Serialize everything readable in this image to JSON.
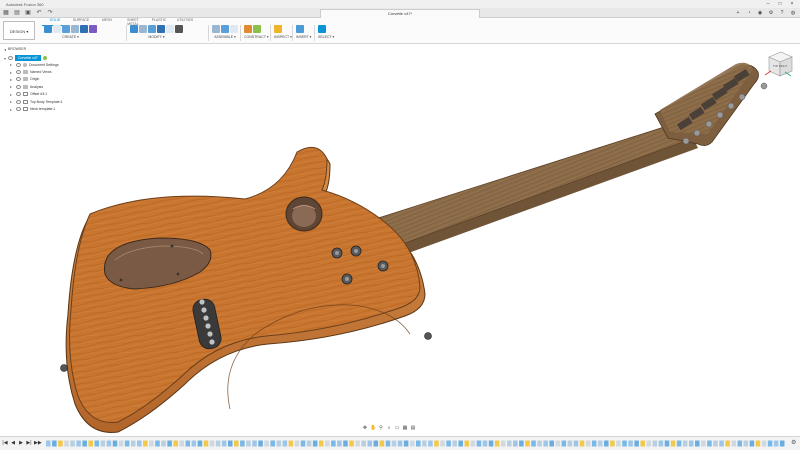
{
  "window": {
    "app_title": "Autodesk Fusion 360",
    "doc_tab_title": "Corvette v47*",
    "controls": [
      "–",
      "□",
      "×"
    ]
  },
  "quick_access": {
    "icons": [
      "grid-icon",
      "file-icon",
      "save-icon",
      "undo-icon",
      "redo-icon"
    ],
    "glyphs": [
      "▦",
      "▤",
      "▣",
      "↶",
      "↷"
    ]
  },
  "tab_right": {
    "glyphs": [
      "+",
      "◔",
      "◉",
      "⚙",
      "?",
      "◍"
    ]
  },
  "ribbon": {
    "workspace": "DESIGN ▾",
    "tabs": [
      "SOLID",
      "SURFACE",
      "MESH",
      "SHEET METAL",
      "PLASTIC",
      "UTILITIES"
    ],
    "active_tab_index": 0,
    "groups": [
      {
        "label": "CREATE ▾",
        "count": 6,
        "colors": [
          "#3b8fd1",
          "#e0e8f1",
          "#5aa0d8",
          "#9ab7d2",
          "#2f6fb4",
          "#7a5bc2"
        ]
      },
      {
        "label": "MODIFY ▾",
        "count": 6,
        "colors": [
          "#3b8fd1",
          "#9ab7d2",
          "#5aa0d8",
          "#2f6fb4",
          "#e0e8f1",
          "#555555"
        ]
      },
      {
        "label": "ASSEMBLE ▾",
        "count": 3,
        "colors": [
          "#9ab7d2",
          "#5aa0d8",
          "#e0e8f1"
        ]
      },
      {
        "label": "CONSTRUCT ▾",
        "count": 2,
        "colors": [
          "#e08b30",
          "#8cc04a"
        ]
      },
      {
        "label": "INSPECT ▾",
        "count": 1,
        "colors": [
          "#f0b429"
        ]
      },
      {
        "label": "INSERT ▾",
        "count": 1,
        "colors": [
          "#4a9bd7"
        ]
      },
      {
        "label": "SELECT ▾",
        "count": 1,
        "colors": [
          "#0696d7"
        ]
      }
    ]
  },
  "browser": {
    "title": "BROWSER",
    "root": "Corvette v47",
    "items": [
      {
        "label": "Document Settings",
        "kind": "gear-icon"
      },
      {
        "label": "Named Views",
        "kind": "folder-icon"
      },
      {
        "label": "Origin",
        "kind": "folder-icon"
      },
      {
        "label": "Analysis",
        "kind": "folder-icon"
      },
      {
        "label": "Offset #3:1",
        "kind": "component-icon"
      },
      {
        "label": "Top Body Template:1",
        "kind": "component-icon"
      },
      {
        "label": "Neck template:1",
        "kind": "component-icon"
      }
    ]
  },
  "viewcube": {
    "face_label": "TOP RIGHT"
  },
  "navbar": {
    "glyphs": [
      "✥",
      "✋",
      "⚲",
      "⌕",
      "▭",
      "▦",
      "▤"
    ]
  },
  "timeline": {
    "control_glyphs": [
      "|◀",
      "◀",
      "▶",
      "▶|",
      "▶▶"
    ],
    "gear_glyph": "⚙",
    "item_count": 122,
    "palette": [
      "#9fc6e8",
      "#6aaee0",
      "#f2c94c",
      "#d1d9e0",
      "#7ab8e8",
      "#b8cfe0"
    ]
  },
  "colors": {
    "accent": "#0696d7",
    "body_wood": "#c8732e",
    "neck_wood": "#8a6a47"
  }
}
